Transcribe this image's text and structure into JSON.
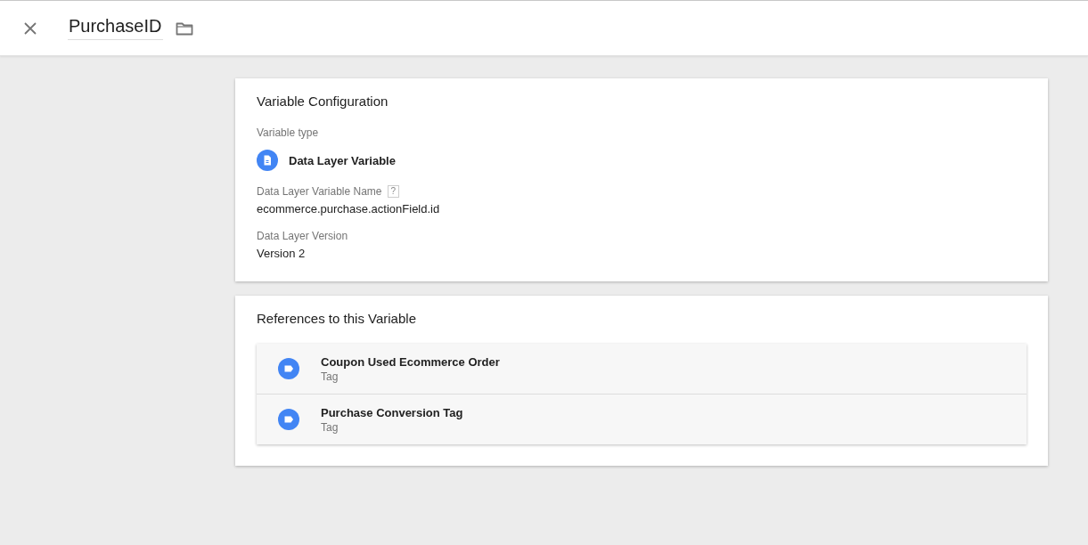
{
  "header": {
    "title": "PurchaseID"
  },
  "configuration": {
    "heading": "Variable Configuration",
    "type_label": "Variable type",
    "type_value": "Data Layer Variable",
    "fields": [
      {
        "label": "Data Layer Variable Name",
        "help": "?",
        "value": "ecommerce.purchase.actionField.id"
      },
      {
        "label": "Data Layer Version",
        "value": "Version 2"
      }
    ]
  },
  "references": {
    "heading": "References to this Variable",
    "items": [
      {
        "name": "Coupon Used Ecommerce Order",
        "type": "Tag"
      },
      {
        "name": "Purchase Conversion Tag",
        "type": "Tag"
      }
    ]
  }
}
